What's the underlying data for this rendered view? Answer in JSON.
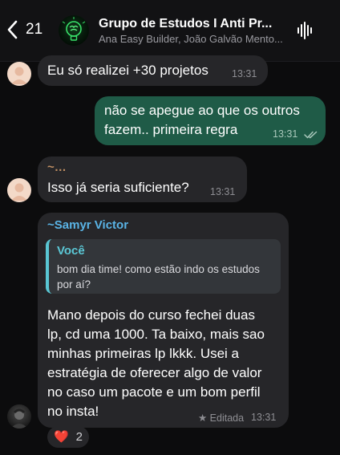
{
  "header": {
    "back_count": "21",
    "title": "Grupo de Estudos I Anti Pr...",
    "subtitle": "Ana Easy Builder, João Galvão Mento..."
  },
  "messages": [
    {
      "id": "m1",
      "direction": "incoming",
      "text": "Eu só realizei +30 projetos",
      "time": "13:31"
    },
    {
      "id": "m2",
      "direction": "outgoing",
      "lines": [
        "não se apegue ao que os outros",
        "fazem.. primeira regra"
      ],
      "time": "13:31",
      "status": "read"
    },
    {
      "id": "m3",
      "direction": "incoming",
      "sender": "~…",
      "text": "Isso já seria suficiente?",
      "time": "13:31"
    },
    {
      "id": "m4",
      "direction": "incoming",
      "sender": "~Samyr Victor",
      "quote": {
        "author": "Você",
        "lines": [
          "bom dia time! como estão indo os estudos",
          "por aí?"
        ]
      },
      "lines": [
        "Mano depois do curso fechei duas",
        "lp, cd uma 1000. Ta baixo, mais sao",
        "minhas primeiras lp lkkk. Usei a",
        "estratégia de oferecer algo de valor",
        "no caso um pacote e um bom perfil",
        "no insta!"
      ],
      "edited_label": "★ Editada",
      "time": "13:31",
      "reaction": {
        "emoji": "❤️",
        "count": "2"
      }
    }
  ],
  "colors": {
    "background": "#0c0c0d",
    "incoming_bubble": "#262629",
    "outgoing_bubble": "#1f5b47",
    "sender_orange": "#c08f63",
    "sender_blue": "#5ab4e6",
    "quote_accent": "#59c6d3"
  },
  "icons": {
    "back": "chevron-left-icon",
    "voice": "waveform-icon",
    "read_receipt": "double-check-icon",
    "reaction": "heart-icon"
  }
}
